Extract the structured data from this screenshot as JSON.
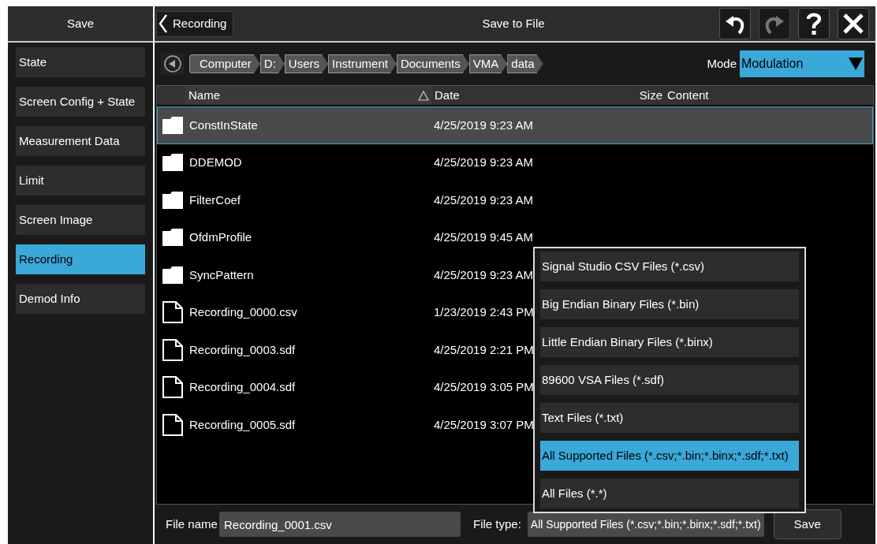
{
  "sidebar": {
    "title": "Save",
    "items": [
      {
        "label": "State",
        "selected": false
      },
      {
        "label": "Screen Config + State",
        "selected": false
      },
      {
        "label": "Measurement Data",
        "selected": false
      },
      {
        "label": "Limit",
        "selected": false
      },
      {
        "label": "Screen Image",
        "selected": false
      },
      {
        "label": "Recording",
        "selected": true
      },
      {
        "label": "Demod Info",
        "selected": false
      }
    ]
  },
  "header": {
    "back_label": "Recording",
    "title": "Save to File",
    "redo_disabled": true
  },
  "path": [
    "Computer",
    "D:",
    "Users",
    "Instrument",
    "Documents",
    "VMA",
    "data"
  ],
  "mode": {
    "label": "Mode",
    "value": "Modulation"
  },
  "table": {
    "columns": [
      "Name",
      "Date",
      "Size",
      "Content"
    ],
    "rows": [
      {
        "kind": "folder",
        "name": "ConstInState",
        "date": "4/25/2019 9:23 AM",
        "selected": true
      },
      {
        "kind": "folder",
        "name": "DDEMOD",
        "date": "4/25/2019 9:23 AM",
        "selected": false
      },
      {
        "kind": "folder",
        "name": "FilterCoef",
        "date": "4/25/2019 9:23 AM",
        "selected": false
      },
      {
        "kind": "folder",
        "name": "OfdmProfile",
        "date": "4/25/2019 9:45 AM",
        "selected": false
      },
      {
        "kind": "folder",
        "name": "SyncPattern",
        "date": "4/25/2019 9:23 AM",
        "selected": false
      },
      {
        "kind": "file",
        "name": "Recording_0000.csv",
        "date": "1/23/2019 2:43 PM",
        "selected": false
      },
      {
        "kind": "file",
        "name": "Recording_0003.sdf",
        "date": "4/25/2019 2:21 PM",
        "selected": false
      },
      {
        "kind": "file",
        "name": "Recording_0004.sdf",
        "date": "4/25/2019 3:05 PM",
        "selected": false
      },
      {
        "kind": "file",
        "name": "Recording_0005.sdf",
        "date": "4/25/2019 3:07 PM",
        "selected": false
      }
    ]
  },
  "file_types": [
    {
      "label": "Signal Studio CSV Files (*.csv)",
      "selected": false
    },
    {
      "label": "Big Endian Binary Files (*.bin)",
      "selected": false
    },
    {
      "label": "Little Endian Binary Files (*.binx)",
      "selected": false
    },
    {
      "label": "89600 VSA Files (*.sdf)",
      "selected": false
    },
    {
      "label": "Text Files (*.txt)",
      "selected": false
    },
    {
      "label": "All Supported Files (*.csv;*.bin;*.binx;*.sdf;*.txt)",
      "selected": true
    },
    {
      "label": "All Files (*.*)",
      "selected": false
    }
  ],
  "footer": {
    "file_name_label": "File name",
    "file_name": "Recording_0001.csv",
    "file_type_label": "File type:",
    "file_type": "All Supported Files (*.csv;*.bin;*.binx;*.sdf;*.txt)",
    "save_label": "Save"
  }
}
